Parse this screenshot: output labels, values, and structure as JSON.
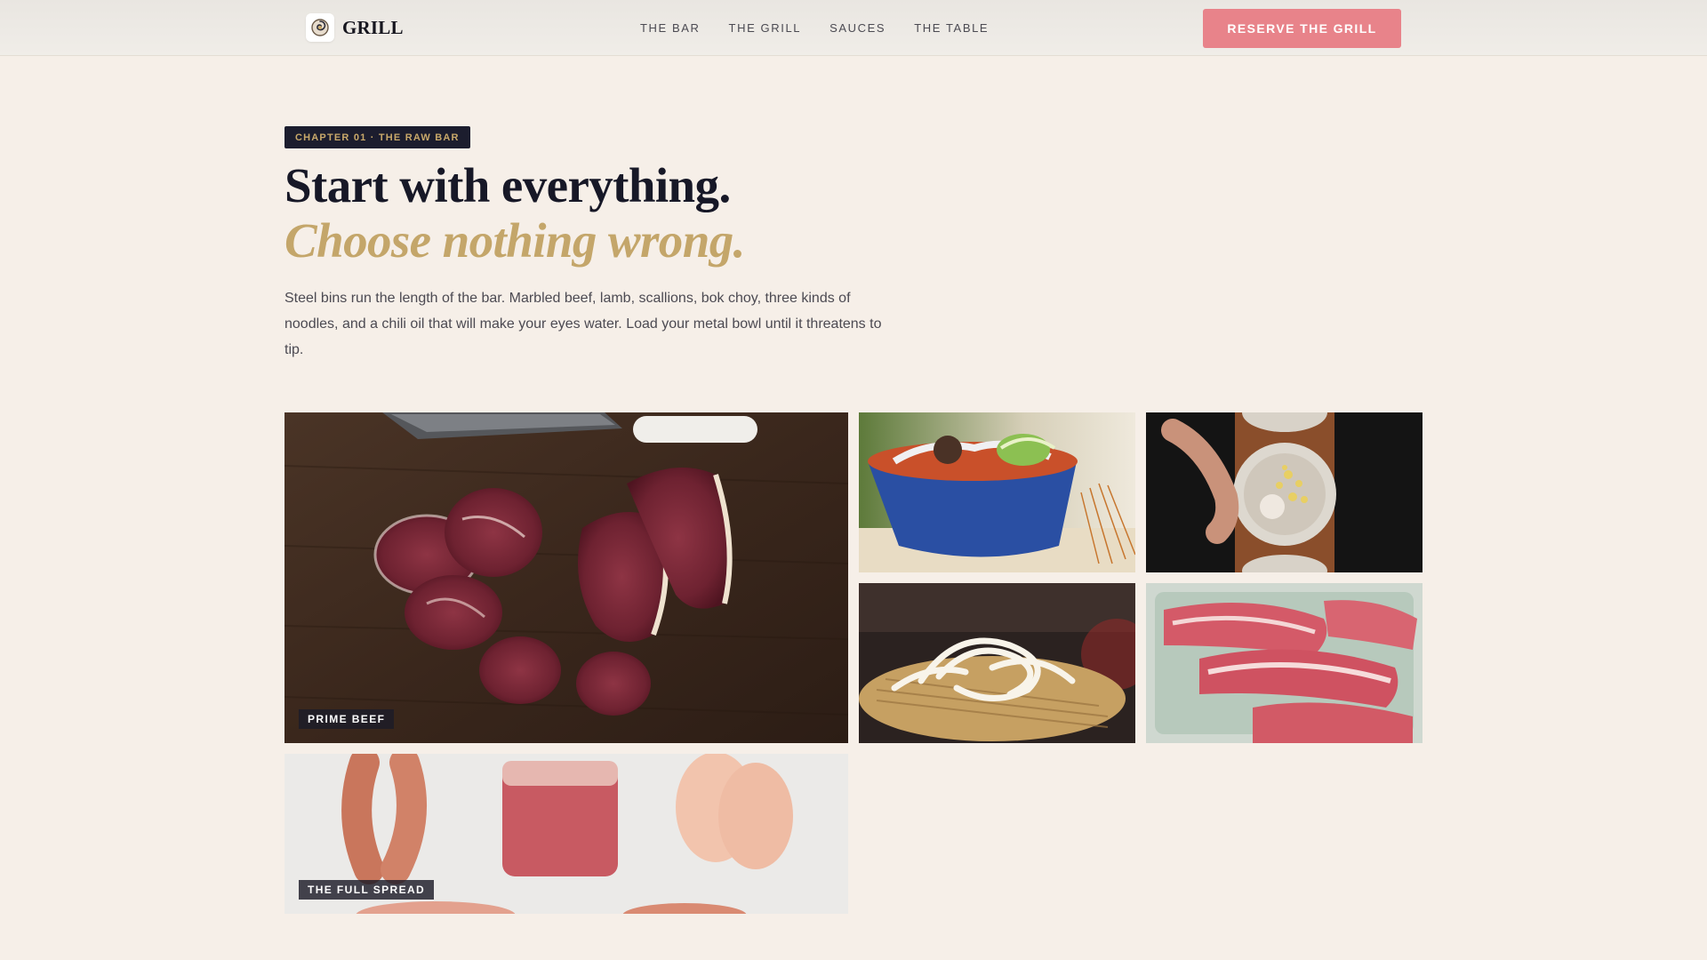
{
  "header": {
    "brand_name": "GRILL",
    "brand_logo_icon": "swirl-logo-icon",
    "nav": [
      "THE BAR",
      "THE GRILL",
      "SAUCES",
      "THE TABLE"
    ],
    "cta_label": "RESERVE THE GRILL",
    "cta_color": "#e8838a"
  },
  "hero": {
    "chapter": "CHAPTER 01 · THE RAW BAR",
    "headline": "Start with everything.",
    "subheadline": "Choose nothing wrong.",
    "intro": "Steel bins run the length of the bar. Marbled beef, lamb, scallions, bok choy, three kinds of noodles, and a chili oil that will make your eyes water. Load your metal bowl until it threatens to tip."
  },
  "gallery": {
    "tiles": [
      {
        "label": "PRIME BEEF",
        "icon": "beef-cuts-image"
      },
      {
        "label": "",
        "icon": "noodle-bowl-image"
      },
      {
        "label": "",
        "icon": "garlic-plate-image"
      },
      {
        "label": "",
        "icon": "udon-noodles-image"
      },
      {
        "label": "",
        "icon": "pork-belly-image"
      },
      {
        "label": "THE FULL SPREAD",
        "icon": "meat-spread-image"
      }
    ]
  },
  "colors": {
    "background": "#f6efe8",
    "ink": "#171827",
    "gold": "#c4a66a",
    "badge": "#1c1d2e"
  }
}
